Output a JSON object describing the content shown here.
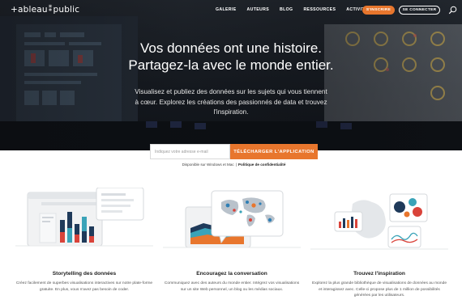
{
  "brand": {
    "logo_text": "+ableau",
    "logo_suffix": "public"
  },
  "nav": {
    "links": [
      "GALERIE",
      "AUTEURS",
      "BLOG",
      "RESSOURCES",
      "ACTIVITÉ"
    ],
    "signup_button": "S'INSCRIRE",
    "login_button": "SE CONNECTER"
  },
  "hero": {
    "headline": "Vos données ont une histoire. Partagez-la avec le monde entier.",
    "subheadline": "Visualisez et publiez des données sur les sujets qui vous tiennent à cœur. Explorez les créations des passionnés de data et trouvez l'inspiration."
  },
  "signup": {
    "email_placeholder": "Indiquez votre adresse e-mail",
    "download_button": "TÉLÉCHARGER L'APPLICATION",
    "availability": "Disponible sur Windows et Mac",
    "separator": "|",
    "privacy_link": "Politique de confidentialité"
  },
  "features": [
    {
      "title": "Storytelling des données",
      "description": "Créez facilement de superbes visualisations interactives sur notre plate-forme gratuite. En plus, vous n'avez pas besoin de coder."
    },
    {
      "title": "Encouragez la conversation",
      "description": "Communiquez avec des auteurs du monde entier. Intégrez vos visualisations sur un site Web personnel, un blog ou les médias sociaux."
    },
    {
      "title": "Trouvez l'inspiration",
      "description": "Explorez la plus grande bibliothèque de visualisations de données au monde et interagissez avec. Celle-ci propose plus de 1 million de possibilités générées par les utilisateurs."
    }
  ],
  "colors": {
    "accent": "#e8762d",
    "hero_dark": "#1a1f26",
    "bar_navy": "#1f3a5a",
    "bar_red": "#d9433a",
    "bar_teal": "#3aa3b8",
    "map_blue": "#2f7fb5"
  },
  "icons": [
    "search-icon"
  ]
}
